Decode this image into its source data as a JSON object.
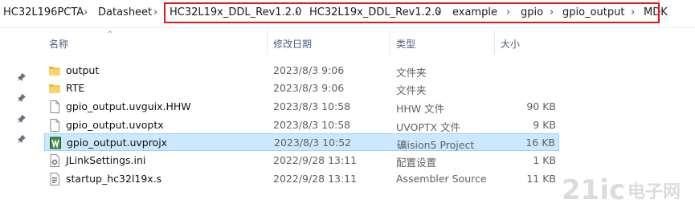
{
  "breadcrumb": [
    "HC32L196PCTA",
    "Datasheet",
    "HC32L19x_DDL_Rev1.2.0",
    "HC32L19x_DDL_Rev1.2.0",
    "example",
    "gpio",
    "gpio_output",
    "MDK"
  ],
  "columns": {
    "name": "名称",
    "date": "修改日期",
    "type": "类型",
    "size": "大小"
  },
  "files": [
    {
      "name": "output",
      "date": "2023/8/3 9:06",
      "type": "文件夹",
      "size": "",
      "icon": "folder-icon"
    },
    {
      "name": "RTE",
      "date": "2023/8/3 9:06",
      "type": "文件夹",
      "size": "",
      "icon": "folder-icon"
    },
    {
      "name": "gpio_output.uvguix.HHW",
      "date": "2023/8/3 10:58",
      "type": "HHW 文件",
      "size": "90 KB",
      "icon": "file-icon"
    },
    {
      "name": "gpio_output.uvoptx",
      "date": "2023/8/3 10:58",
      "type": "UVOPTX 文件",
      "size": "9 KB",
      "icon": "file-icon"
    },
    {
      "name": "gpio_output.uvprojx",
      "date": "2023/8/3 10:52",
      "type": "礦ision5 Project",
      "size": "16 KB",
      "icon": "keil-project-icon",
      "selected": true
    },
    {
      "name": "JLinkSettings.ini",
      "date": "2022/9/28 13:11",
      "type": "配置设置",
      "size": "1 KB",
      "icon": "settings-file-icon"
    },
    {
      "name": "startup_hc32l19x.s",
      "date": "2022/9/28 13:11",
      "type": "Assembler Source",
      "size": "11 KB",
      "icon": "assembler-file-icon"
    }
  ],
  "watermark": {
    "brand": "21ic",
    "cn": "电子网"
  },
  "colors": {
    "highlight": "#e0161b",
    "selected_bg": "#cce8ff",
    "folder": "#f5c242",
    "watermark": "#d9d9d9"
  }
}
